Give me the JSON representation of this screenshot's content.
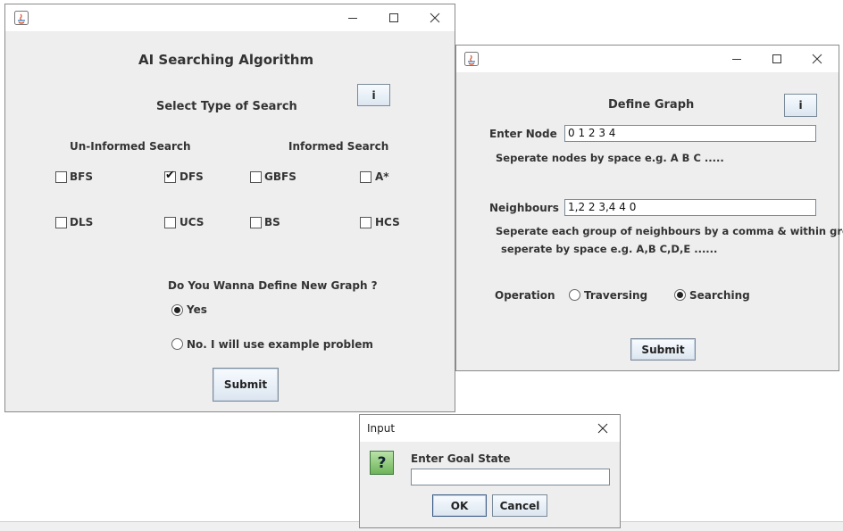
{
  "main_window": {
    "heading": "AI Searching Algorithm",
    "select_type_label": "Select Type of Search",
    "info_button": "i",
    "uninformed_label": "Un-Informed Search",
    "informed_label": "Informed Search",
    "options": [
      {
        "label": "BFS",
        "checked": false
      },
      {
        "label": "DFS",
        "checked": true
      },
      {
        "label": "GBFS",
        "checked": false
      },
      {
        "label": "A*",
        "checked": false
      },
      {
        "label": "DLS",
        "checked": false
      },
      {
        "label": "UCS",
        "checked": false
      },
      {
        "label": "BS",
        "checked": false
      },
      {
        "label": "HCS",
        "checked": false
      }
    ],
    "question": "Do You Wanna Define New Graph ?",
    "radio_yes": "Yes",
    "radio_no": "No. I will use example problem",
    "selected_radio": "yes",
    "submit": "Submit"
  },
  "graph_window": {
    "heading": "Define Graph",
    "info_button": "i",
    "enter_node_label": "Enter Node",
    "enter_node_value": "0 1 2 3 4",
    "node_hint": "Seperate nodes by space e.g. A B C .....",
    "neighbours_label": "Neighbours",
    "neighbours_value": "1,2 2 3,4 4 0",
    "neighbours_hint_1": "Seperate each group of neighbours by a comma & within group",
    "neighbours_hint_2": "seperate by space e.g. A,B C,D,E ......",
    "operation_label": "Operation",
    "radio_traversing": "Traversing",
    "radio_searching": "Searching",
    "selected_operation": "searching",
    "submit": "Submit"
  },
  "input_dialog": {
    "title": "Input",
    "question_icon_glyph": "?",
    "prompt": "Enter Goal State",
    "value": "",
    "ok": "OK",
    "cancel": "Cancel"
  }
}
